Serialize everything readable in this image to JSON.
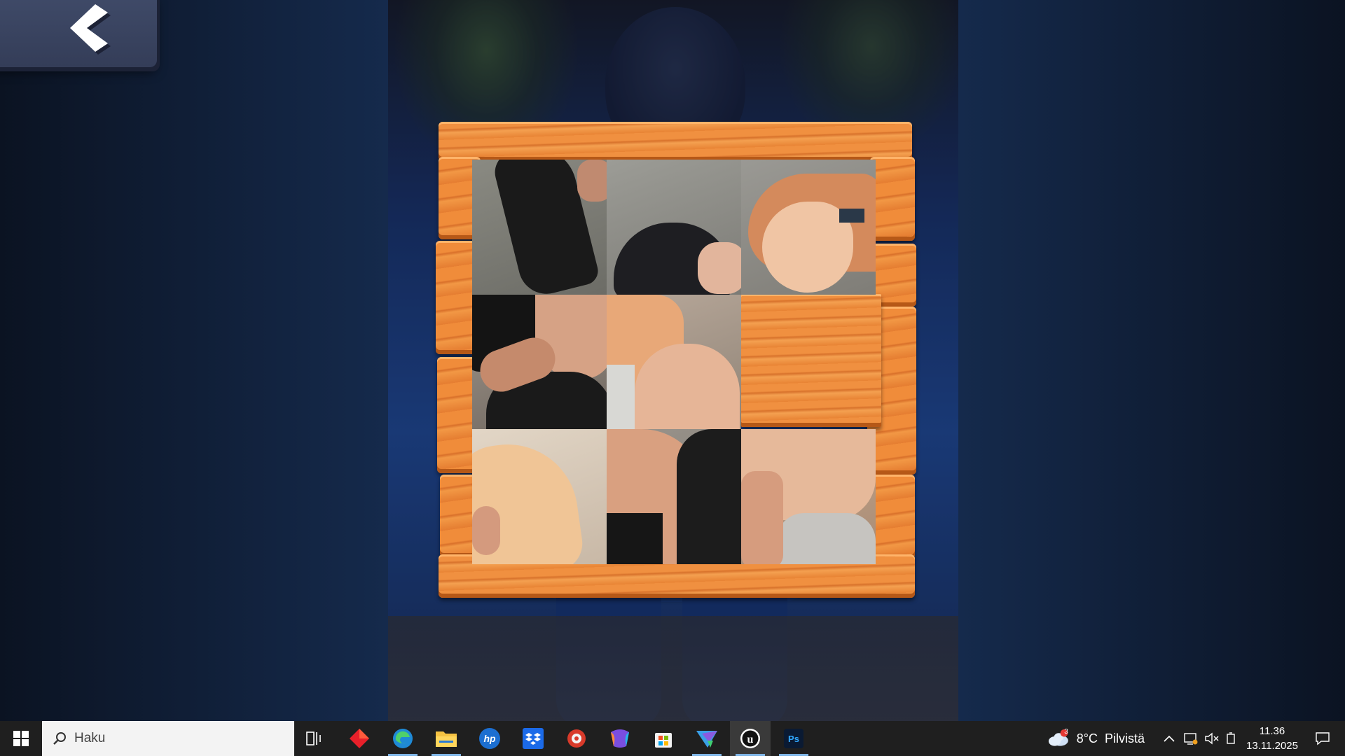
{
  "game": {
    "back_button_label": "",
    "puzzle": {
      "rows": 3,
      "cols": 3,
      "empty_tile": {
        "row": 1,
        "col": 2
      }
    }
  },
  "taskbar": {
    "search_placeholder": "Haku",
    "pinned_apps": [
      "task-view-icon",
      "red-diamond-app-icon",
      "edge-browser-icon",
      "file-explorer-icon",
      "hp-app-icon",
      "dropbox-icon",
      "red-circle-app-icon",
      "m365-copilot-icon",
      "microsoft-store-icon",
      "vector-app-icon",
      "unreal-engine-icon",
      "photoshop-icon"
    ],
    "weather": {
      "badge": "3",
      "text": "8°C  Pilvistä"
    },
    "clock": {
      "time": "11.36",
      "date": "13.11.2025"
    }
  },
  "colors": {
    "wood": "#f08c3a",
    "back_button": "#3f4a68",
    "taskbar": "#1f1f1f"
  }
}
